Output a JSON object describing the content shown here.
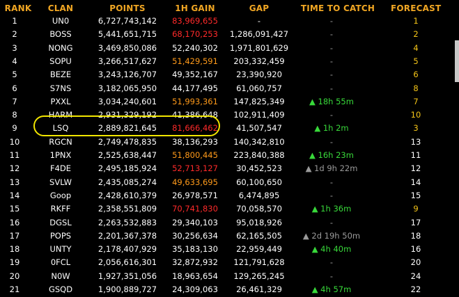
{
  "colors": {
    "header": "#f0a623",
    "gain_red": "#ff2a2a",
    "gain_orange": "#ff9a1a",
    "forecast_yellow": "#f5c518",
    "green": "#38d93a",
    "grey": "#9a9a9a",
    "highlight": "#f2e600"
  },
  "headers": {
    "rank": "RANK",
    "clan": "CLAN",
    "points": "POINTS",
    "gain": "1H GAIN",
    "gap": "GAP",
    "ttc": "TIME TO CATCH",
    "forecast": "FORECAST"
  },
  "rows": [
    {
      "rank": "1",
      "clan": "UN0",
      "points": "6,727,743,142",
      "gain": "83,969,655",
      "gain_color": "red",
      "gap": "-",
      "ttc": "-",
      "ttc_color": "grey",
      "forecast": "1",
      "forecast_color": "yellow"
    },
    {
      "rank": "2",
      "clan": "BOSS",
      "points": "5,441,651,715",
      "gain": "68,170,253",
      "gain_color": "red",
      "gap": "1,286,091,427",
      "ttc": "-",
      "ttc_color": "grey",
      "forecast": "2",
      "forecast_color": "yellow"
    },
    {
      "rank": "3",
      "clan": "NONG",
      "points": "3,469,850,086",
      "gain": "52,240,302",
      "gain_color": "white",
      "gap": "1,971,801,629",
      "ttc": "-",
      "ttc_color": "grey",
      "forecast": "4",
      "forecast_color": "yellow"
    },
    {
      "rank": "4",
      "clan": "SOPU",
      "points": "3,266,517,627",
      "gain": "51,429,591",
      "gain_color": "orange",
      "gap": "203,332,459",
      "ttc": "-",
      "ttc_color": "grey",
      "forecast": "5",
      "forecast_color": "yellow"
    },
    {
      "rank": "5",
      "clan": "BEZE",
      "points": "3,243,126,707",
      "gain": "49,352,167",
      "gain_color": "white",
      "gap": "23,390,920",
      "ttc": "-",
      "ttc_color": "grey",
      "forecast": "6",
      "forecast_color": "yellow"
    },
    {
      "rank": "6",
      "clan": "S7NS",
      "points": "3,182,065,950",
      "gain": "44,177,495",
      "gain_color": "white",
      "gap": "61,060,757",
      "ttc": "-",
      "ttc_color": "grey",
      "forecast": "8",
      "forecast_color": "yellow"
    },
    {
      "rank": "7",
      "clan": "PXXL",
      "points": "3,034,240,601",
      "gain": "51,993,361",
      "gain_color": "orange",
      "gap": "147,825,349",
      "ttc": "▲ 18h 55m",
      "ttc_color": "green",
      "forecast": "7",
      "forecast_color": "yellow"
    },
    {
      "rank": "8",
      "clan": "HARM",
      "points": "2,931,329,192",
      "gain": "41,386,648",
      "gain_color": "white",
      "gap": "102,911,409",
      "ttc": "-",
      "ttc_color": "grey",
      "forecast": "10",
      "forecast_color": "yellow"
    },
    {
      "rank": "9",
      "clan": "LSQ",
      "points": "2,889,821,645",
      "gain": "81,666,462",
      "gain_color": "red",
      "gap": "41,507,547",
      "ttc": "▲ 1h 2m",
      "ttc_color": "green",
      "forecast": "3",
      "forecast_color": "yellow"
    },
    {
      "rank": "10",
      "clan": "RGCN",
      "points": "2,749,478,835",
      "gain": "38,136,293",
      "gain_color": "white",
      "gap": "140,342,810",
      "ttc": "-",
      "ttc_color": "grey",
      "forecast": "13",
      "forecast_color": "white"
    },
    {
      "rank": "11",
      "clan": "1PNX",
      "points": "2,525,638,447",
      "gain": "51,800,445",
      "gain_color": "orange",
      "gap": "223,840,388",
      "ttc": "▲ 16h 23m",
      "ttc_color": "green",
      "forecast": "11",
      "forecast_color": "white"
    },
    {
      "rank": "12",
      "clan": "F4DE",
      "points": "2,495,185,924",
      "gain": "52,713,127",
      "gain_color": "red",
      "gap": "30,452,523",
      "ttc": "▲ 1d 9h 22m",
      "ttc_color": "grey",
      "forecast": "12",
      "forecast_color": "white"
    },
    {
      "rank": "13",
      "clan": "SVLW",
      "points": "2,435,085,274",
      "gain": "49,633,695",
      "gain_color": "orange",
      "gap": "60,100,650",
      "ttc": "-",
      "ttc_color": "grey",
      "forecast": "14",
      "forecast_color": "white"
    },
    {
      "rank": "14",
      "clan": "Goop",
      "points": "2,428,610,379",
      "gain": "26,978,571",
      "gain_color": "white",
      "gap": "6,474,895",
      "ttc": "-",
      "ttc_color": "grey",
      "forecast": "15",
      "forecast_color": "white"
    },
    {
      "rank": "15",
      "clan": "RKFF",
      "points": "2,358,551,809",
      "gain": "70,741,830",
      "gain_color": "red",
      "gap": "70,058,570",
      "ttc": "▲ 1h 36m",
      "ttc_color": "green",
      "forecast": "9",
      "forecast_color": "yellow"
    },
    {
      "rank": "16",
      "clan": "DGSL",
      "points": "2,263,532,883",
      "gain": "29,340,103",
      "gain_color": "white",
      "gap": "95,018,926",
      "ttc": "-",
      "ttc_color": "grey",
      "forecast": "17",
      "forecast_color": "white"
    },
    {
      "rank": "17",
      "clan": "POPS",
      "points": "2,201,367,378",
      "gain": "30,256,634",
      "gain_color": "white",
      "gap": "62,165,505",
      "ttc": "▲ 2d 19h 50m",
      "ttc_color": "grey",
      "forecast": "18",
      "forecast_color": "white"
    },
    {
      "rank": "18",
      "clan": "UNTY",
      "points": "2,178,407,929",
      "gain": "35,183,130",
      "gain_color": "white",
      "gap": "22,959,449",
      "ttc": "▲ 4h 40m",
      "ttc_color": "green",
      "forecast": "16",
      "forecast_color": "white"
    },
    {
      "rank": "19",
      "clan": "0FCL",
      "points": "2,056,616,301",
      "gain": "32,872,932",
      "gain_color": "white",
      "gap": "121,791,628",
      "ttc": "-",
      "ttc_color": "grey",
      "forecast": "20",
      "forecast_color": "white"
    },
    {
      "rank": "20",
      "clan": "N0W",
      "points": "1,927,351,056",
      "gain": "18,963,654",
      "gain_color": "white",
      "gap": "129,265,245",
      "ttc": "-",
      "ttc_color": "grey",
      "forecast": "24",
      "forecast_color": "white"
    },
    {
      "rank": "21",
      "clan": "GSQD",
      "points": "1,900,889,727",
      "gain": "24,309,063",
      "gain_color": "white",
      "gap": "26,461,329",
      "ttc": "▲ 4h 57m",
      "ttc_color": "green",
      "forecast": "22",
      "forecast_color": "white"
    }
  ]
}
